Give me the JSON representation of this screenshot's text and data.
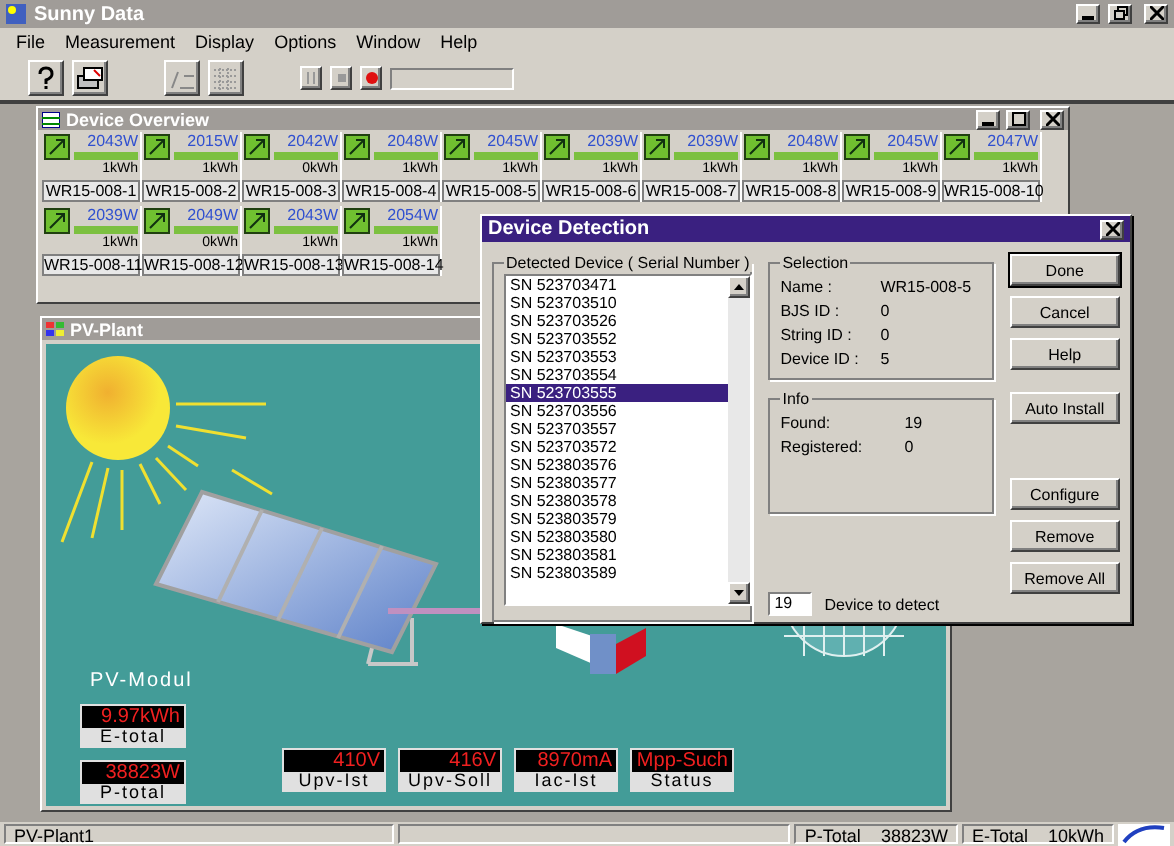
{
  "window": {
    "title": "Sunny Data"
  },
  "menu": [
    "File",
    "Measurement",
    "Display",
    "Options",
    "Window",
    "Help"
  ],
  "device_overview": {
    "title": "Device Overview",
    "rows": [
      [
        {
          "power": "2043W",
          "energy": "1kWh",
          "name": "WR15-008-1"
        },
        {
          "power": "2015W",
          "energy": "1kWh",
          "name": "WR15-008-2"
        },
        {
          "power": "2042W",
          "energy": "0kWh",
          "name": "WR15-008-3"
        },
        {
          "power": "2048W",
          "energy": "1kWh",
          "name": "WR15-008-4"
        },
        {
          "power": "2045W",
          "energy": "1kWh",
          "name": "WR15-008-5"
        },
        {
          "power": "2039W",
          "energy": "1kWh",
          "name": "WR15-008-6"
        },
        {
          "power": "2039W",
          "energy": "1kWh",
          "name": "WR15-008-7"
        },
        {
          "power": "2048W",
          "energy": "1kWh",
          "name": "WR15-008-8"
        },
        {
          "power": "2045W",
          "energy": "1kWh",
          "name": "WR15-008-9"
        },
        {
          "power": "2047W",
          "energy": "1kWh",
          "name": "WR15-008-10"
        }
      ],
      [
        {
          "power": "2039W",
          "energy": "1kWh",
          "name": "WR15-008-11"
        },
        {
          "power": "2049W",
          "energy": "0kWh",
          "name": "WR15-008-12"
        },
        {
          "power": "2043W",
          "energy": "1kWh",
          "name": "WR15-008-13"
        },
        {
          "power": "2054W",
          "energy": "1kWh",
          "name": "WR15-008-14"
        }
      ]
    ]
  },
  "pv_plant": {
    "title": "PV-Plant",
    "module_label": "PV-Modul",
    "totals": [
      {
        "value": "9.97kWh",
        "label": "E-total"
      },
      {
        "value": "38823W",
        "label": "P-total"
      }
    ],
    "readings": [
      {
        "value": "410V",
        "label": "Upv-Ist"
      },
      {
        "value": "416V",
        "label": "Upv-Soll"
      },
      {
        "value": "8970mA",
        "label": "Iac-Ist"
      },
      {
        "value": "Mpp-Such",
        "label": "Status"
      }
    ]
  },
  "dialog": {
    "title": "Device Detection",
    "list_label": "Detected Device ( Serial Number )",
    "devices": [
      {
        "label": "SN 523703471",
        "selected": false
      },
      {
        "label": "SN 523703510",
        "selected": false
      },
      {
        "label": "SN 523703526",
        "selected": false
      },
      {
        "label": "SN 523703552",
        "selected": false
      },
      {
        "label": "SN 523703553",
        "selected": false
      },
      {
        "label": "SN 523703554",
        "selected": false
      },
      {
        "label": "SN 523703555",
        "selected": true
      },
      {
        "label": "SN 523703556",
        "selected": false
      },
      {
        "label": "SN 523703557",
        "selected": false
      },
      {
        "label": "SN 523703572",
        "selected": false
      },
      {
        "label": "SN 523803576",
        "selected": false
      },
      {
        "label": "SN 523803577",
        "selected": false
      },
      {
        "label": "SN 523803578",
        "selected": false
      },
      {
        "label": "SN 523803579",
        "selected": false
      },
      {
        "label": "SN 523803580",
        "selected": false
      },
      {
        "label": "SN 523803581",
        "selected": false
      },
      {
        "label": "SN 523803589",
        "selected": false
      }
    ],
    "selection_label": "Selection",
    "selection": [
      {
        "label": "Name :",
        "value": "WR15-008-5"
      },
      {
        "label": "BJS ID :",
        "value": "0"
      },
      {
        "label": "String ID :",
        "value": "0"
      },
      {
        "label": "Device ID :",
        "value": "5"
      }
    ],
    "info_label": "Info",
    "info": [
      {
        "label": "Found:",
        "value": "19"
      },
      {
        "label": "Registered:",
        "value": "0"
      }
    ],
    "detect_count": "19",
    "detect_label": "Device to detect",
    "buttons": [
      "Done",
      "Cancel",
      "Help",
      "Auto Install",
      "Configure",
      "Remove",
      "Remove All"
    ]
  },
  "status_bar": {
    "name": "PV-Plant1",
    "fields": [
      {
        "label": "P-Total",
        "value": "38823W"
      },
      {
        "label": "E-Total",
        "value": "10kWh"
      }
    ]
  }
}
